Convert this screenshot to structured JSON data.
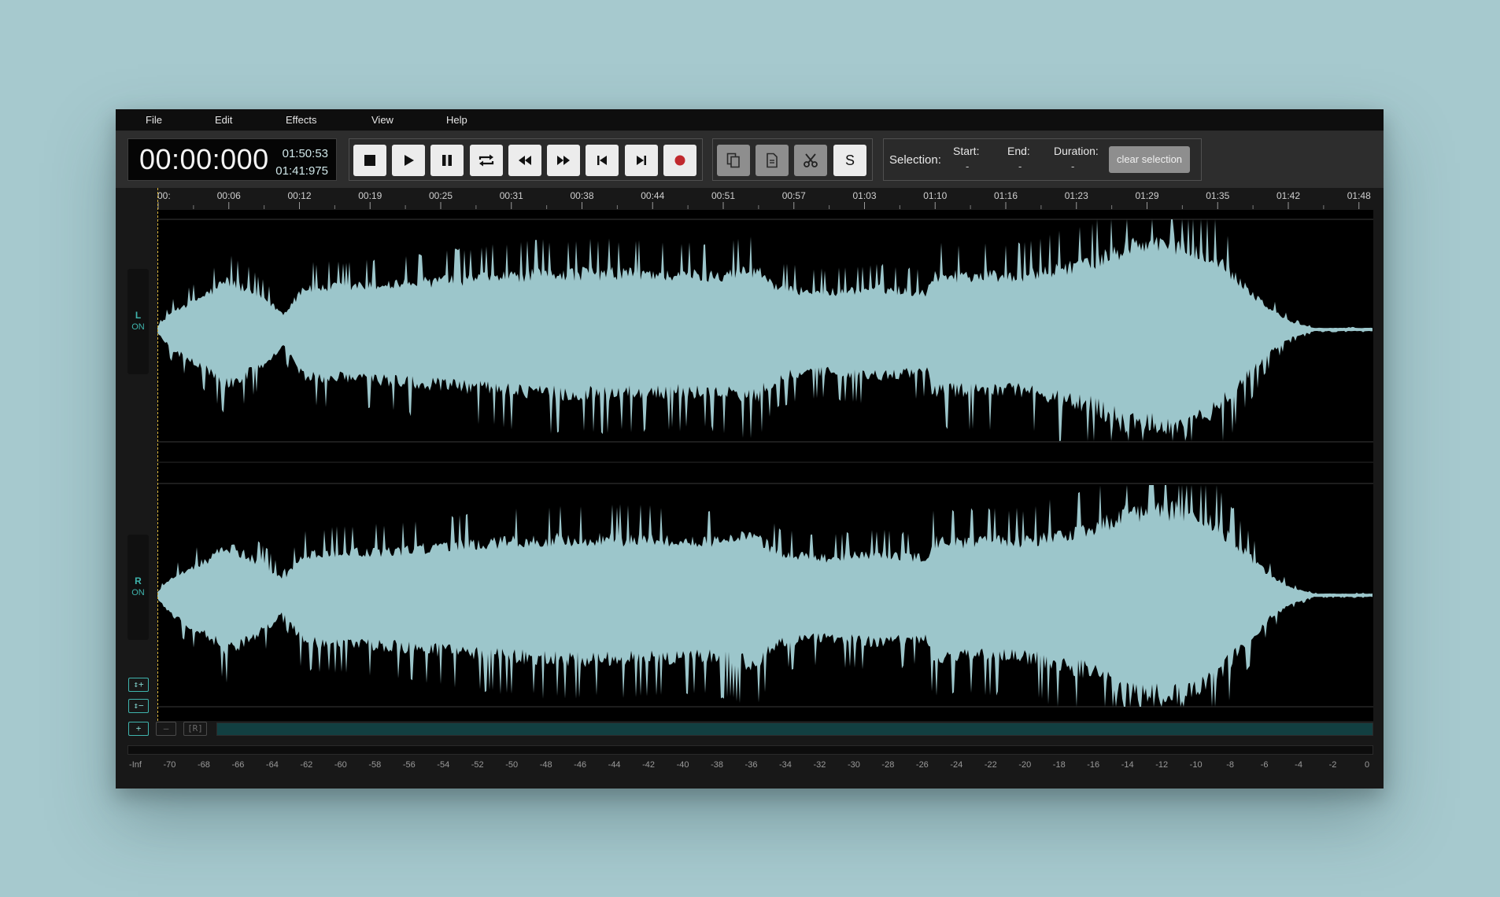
{
  "menu": [
    "File",
    "Edit",
    "Effects",
    "View",
    "Help"
  ],
  "time": {
    "current": "00:00:000",
    "total": "01:50:53",
    "secondary": "01:41:975"
  },
  "transport": [
    {
      "name": "stop",
      "icon": "stop-icon"
    },
    {
      "name": "play",
      "icon": "play-icon"
    },
    {
      "name": "pause",
      "icon": "pause-icon"
    },
    {
      "name": "loop",
      "icon": "loop-icon"
    },
    {
      "name": "rewind",
      "icon": "rewind-icon"
    },
    {
      "name": "fast-forward",
      "icon": "fast-forward-icon"
    },
    {
      "name": "skip-to-start",
      "icon": "skip-start-icon"
    },
    {
      "name": "skip-to-end",
      "icon": "skip-end-icon"
    },
    {
      "name": "record",
      "icon": "record-icon",
      "color": "#c0282d"
    }
  ],
  "edit_tools": {
    "copy_icon": "copy-icon",
    "paste_icon": "paste-icon",
    "cut_icon": "scissors-icon",
    "s_label": "S"
  },
  "selection": {
    "label": "Selection:",
    "start_label": "Start:",
    "start_value": "-",
    "end_label": "End:",
    "end_value": "-",
    "duration_label": "Duration:",
    "duration_value": "-",
    "clear_label": "clear selection"
  },
  "timeline_ticks": [
    "00:",
    "00:06",
    "00:12",
    "00:19",
    "00:25",
    "00:31",
    "00:38",
    "00:44",
    "00:51",
    "00:57",
    "01:03",
    "01:10",
    "01:16",
    "01:23",
    "01:29",
    "01:35",
    "01:42",
    "01:48"
  ],
  "channels": [
    {
      "name": "L",
      "state": "ON"
    },
    {
      "name": "R",
      "state": "ON"
    }
  ],
  "zoom_controls": {
    "v_zoom_in": "↕+",
    "v_zoom_out": "↕−",
    "h_zoom_in": "+",
    "h_zoom_out": "–",
    "reset": "[R]"
  },
  "meter_scale": [
    "-Inf",
    "-70",
    "-68",
    "-66",
    "-64",
    "-62",
    "-60",
    "-58",
    "-56",
    "-54",
    "-52",
    "-50",
    "-48",
    "-46",
    "-44",
    "-42",
    "-40",
    "-38",
    "-36",
    "-34",
    "-32",
    "-30",
    "-28",
    "-26",
    "-24",
    "-22",
    "-20",
    "-18",
    "-16",
    "-14",
    "-12",
    "-10",
    "-8",
    "-6",
    "-4",
    "-2",
    "0"
  ],
  "colors": {
    "waveform": "#9cc6cb",
    "accent": "#3fb4ad",
    "playhead": "#d8b43c",
    "background": "#a6c9ce"
  }
}
